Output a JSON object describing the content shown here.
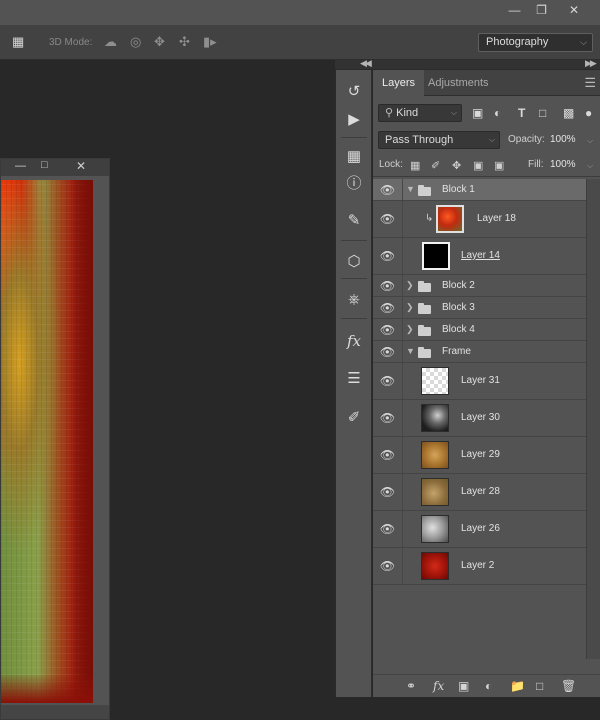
{
  "workspace": {
    "selected": "Photography"
  },
  "options_bar": {
    "mode_label": "3D Mode:"
  },
  "panel": {
    "tabs": [
      {
        "label": "Layers",
        "active": true
      },
      {
        "label": "Adjustments",
        "active": false
      }
    ],
    "filter": {
      "kind_label": "Kind"
    },
    "blend_mode": "Pass Through",
    "opacity_label": "Opacity:",
    "opacity_value": "100%",
    "lock_label": "Lock:",
    "fill_label": "Fill:",
    "fill_value": "100%"
  },
  "layers": [
    {
      "name": "Block 1",
      "type": "group",
      "expanded": true,
      "selected": true
    },
    {
      "name": "Layer 18",
      "type": "layer",
      "clipped": true,
      "thumb_colors": [
        "#b31a08",
        "#e04a18",
        "#7a6a2a"
      ]
    },
    {
      "name": "Layer 14",
      "type": "layer",
      "underlined": true,
      "thumb_colors": [
        "#000000",
        "#000000",
        "#ffffff"
      ]
    },
    {
      "name": "Block 2",
      "type": "group",
      "expanded": false
    },
    {
      "name": "Block 3",
      "type": "group",
      "expanded": false
    },
    {
      "name": "Block 4",
      "type": "group",
      "expanded": false
    },
    {
      "name": "Frame",
      "type": "group",
      "expanded": true
    },
    {
      "name": "Layer 31",
      "type": "layer",
      "thumb_colors": [
        "#ffffff",
        "#d9d9d9",
        "#ffffff"
      ]
    },
    {
      "name": "Layer 30",
      "type": "layer",
      "thumb_colors": [
        "#2a2a2a",
        "#cfcfcf",
        "#6a6a6a"
      ]
    },
    {
      "name": "Layer 29",
      "type": "layer",
      "thumb_colors": [
        "#a8742e",
        "#d6a45a",
        "#7a4e1e"
      ]
    },
    {
      "name": "Layer 28",
      "type": "layer",
      "thumb_colors": [
        "#8a6a3a",
        "#c4a46a",
        "#6a5a2a"
      ]
    },
    {
      "name": "Layer 26",
      "type": "layer",
      "thumb_colors": [
        "#9a9a9a",
        "#e0e0e0",
        "#4a4a4a"
      ]
    },
    {
      "name": "Layer 2",
      "type": "layer",
      "thumb_colors": [
        "#a0140a",
        "#d22a18",
        "#6a0a04"
      ]
    }
  ]
}
